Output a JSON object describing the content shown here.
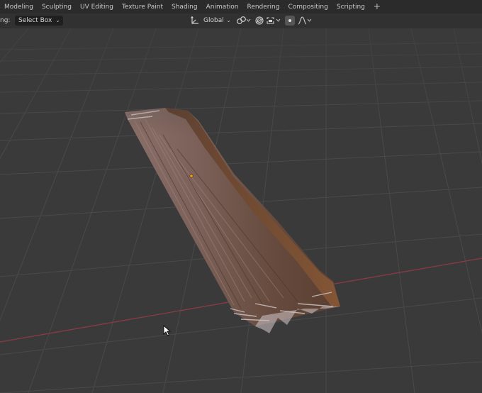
{
  "workspace_tabs": [
    "Modeling",
    "Sculpting",
    "UV Editing",
    "Texture Paint",
    "Shading",
    "Animation",
    "Rendering",
    "Compositing",
    "Scripting"
  ],
  "add_tab_label": "+",
  "header": {
    "tool_label_fragment": "ng:",
    "select_mode": "Select Box",
    "transform_orientation": "Global"
  },
  "colors": {
    "viewport_bg": "#3a3a3a",
    "grid_line": "#4a4a4a",
    "x_axis": "#8b3b47",
    "wood_dark": "#5c4236",
    "wood_light": "#8a7068",
    "origin_dot": "#f0a020"
  },
  "icons": [
    "orientation-icon",
    "pivot-chain-icon",
    "proportional-edit-icon",
    "snap-icon",
    "snap-toggle-icon",
    "falloff-icon",
    "mouse-cursor-icon"
  ]
}
